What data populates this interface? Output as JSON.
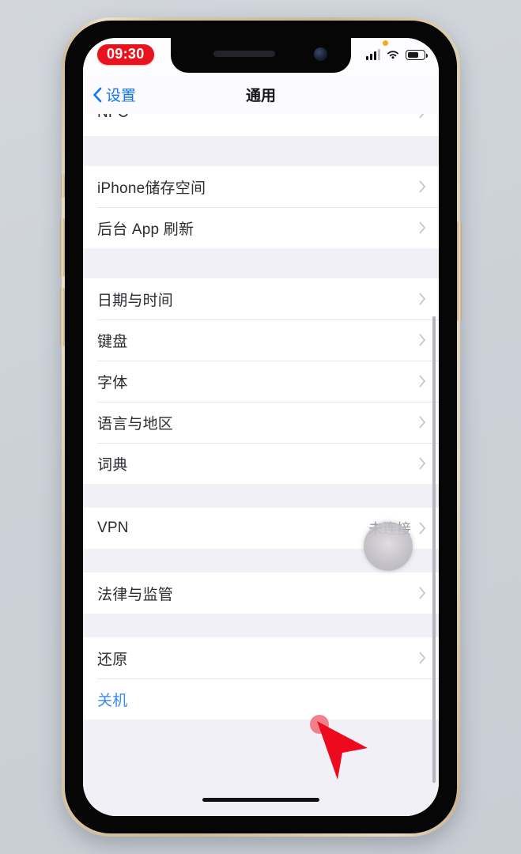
{
  "status_bar": {
    "time": "09:30",
    "recording_pill_color": "#e8131c",
    "icons": {
      "privacy_dot": "privacy-dot-icon",
      "cellular": "signal-bars-icon",
      "wifi": "wifi-icon",
      "battery": "battery-icon"
    }
  },
  "nav": {
    "back_label": "设置",
    "title": "通用",
    "accent_color": "#1076f5"
  },
  "list": {
    "partial_top_row": {
      "label": "NFC",
      "value": "",
      "chevron": true
    },
    "groups": [
      {
        "rows": [
          {
            "label": "iPhone储存空间",
            "value": "",
            "chevron": true
          },
          {
            "label": "后台 App 刷新",
            "value": "",
            "chevron": true
          }
        ]
      },
      {
        "rows": [
          {
            "label": "日期与时间",
            "value": "",
            "chevron": true
          },
          {
            "label": "键盘",
            "value": "",
            "chevron": true
          },
          {
            "label": "字体",
            "value": "",
            "chevron": true
          },
          {
            "label": "语言与地区",
            "value": "",
            "chevron": true
          },
          {
            "label": "词典",
            "value": "",
            "chevron": true
          }
        ]
      },
      {
        "rows": [
          {
            "label": "VPN",
            "value": "未连接",
            "chevron": true
          }
        ]
      },
      {
        "rows": [
          {
            "label": "法律与监管",
            "value": "",
            "chevron": true
          }
        ]
      },
      {
        "rows": [
          {
            "label": "还原",
            "value": "",
            "chevron": true
          },
          {
            "label": "关机",
            "value": "",
            "chevron": false,
            "link": true
          }
        ]
      }
    ]
  },
  "overlays": {
    "tap_indicator": "touch-tap-indicator",
    "cursor": "red-arrow-cursor",
    "cursor_color": "#ee0a1e",
    "scrollbar": "vertical-scrollbar"
  },
  "device": {
    "home_indicator": "home-indicator",
    "frame_color": "#d8c6a6",
    "buttons": [
      "ringer-switch",
      "volume-up-button",
      "volume-down-button",
      "power-button"
    ]
  }
}
